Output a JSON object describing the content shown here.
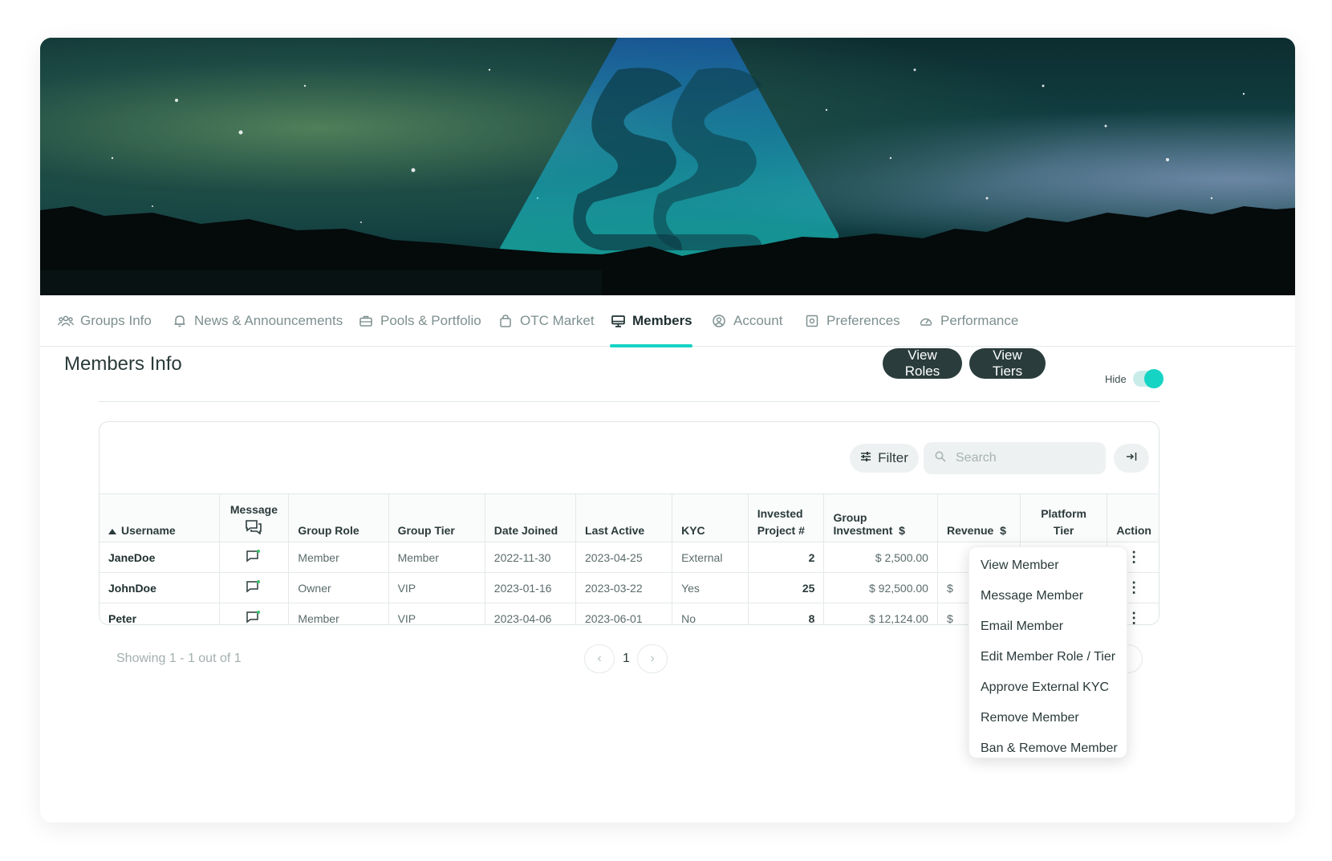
{
  "tabs": [
    {
      "label": "Groups Info",
      "icon": "group-icon"
    },
    {
      "label": "News & Announcements",
      "icon": "bell-icon"
    },
    {
      "label": "Pools & Portfolio",
      "icon": "briefcase-icon"
    },
    {
      "label": "OTC Market",
      "icon": "bag-icon"
    },
    {
      "label": "Members",
      "icon": "monitor-icon"
    },
    {
      "label": "Account",
      "icon": "user-circle-icon"
    },
    {
      "label": "Preferences",
      "icon": "settings-square-icon"
    },
    {
      "label": "Performance",
      "icon": "gauge-icon"
    }
  ],
  "active_tab": "Members",
  "section": {
    "title": "Members Info",
    "view_roles": "View Roles",
    "view_tiers": "View Tiers",
    "hide_label": "Hide",
    "hide_toggle_on": true
  },
  "toolbar": {
    "filter_label": "Filter",
    "search_placeholder": "Search"
  },
  "table": {
    "headers": {
      "username": "Username",
      "message": "Message",
      "group_role": "Group Role",
      "group_tier": "Group Tier",
      "date_joined": "Date Joined",
      "last_active": "Last Active",
      "kyc": "KYC",
      "invested_1": "Invested",
      "invested_2": "Project #",
      "group_investment": "Group Investment",
      "group_investment_unit": "$",
      "revenue": "Revenue",
      "revenue_unit": "$",
      "platform_1": "Platform",
      "platform_2": "Tier",
      "action": "Action"
    },
    "rows": [
      {
        "username": "JaneDoe",
        "group_role": "Member",
        "group_tier": "Member",
        "date_joined": "2022-11-30",
        "last_active": "2023-04-25",
        "kyc": "External",
        "invested": "2",
        "group_investment": "$ 2,500.00",
        "revenue": "",
        "platform_tier": ""
      },
      {
        "username": "JohnDoe",
        "group_role": "Owner",
        "group_tier": "VIP",
        "date_joined": "2023-01-16",
        "last_active": "2023-03-22",
        "kyc": "Yes",
        "invested": "25",
        "group_investment": "$ 92,500.00",
        "revenue": "$",
        "platform_tier": ""
      },
      {
        "username": "Peter",
        "group_role": "Member",
        "group_tier": "VIP",
        "date_joined": "2023-04-06",
        "last_active": "2023-06-01",
        "kyc": "No",
        "invested": "8",
        "group_investment": "$ 12,124.00",
        "revenue": "$",
        "platform_tier": ""
      }
    ]
  },
  "footer": {
    "showing": "Showing 1 - 1 out of 1",
    "page": "1"
  },
  "action_menu": [
    "View Member",
    "Message Member",
    "Email Member",
    "Edit Member Role / Tier",
    "Approve External KYC",
    "Remove Member",
    "Ban & Remove Member"
  ],
  "colors": {
    "accent": "#16d4c4",
    "dark_button": "#2a3c3c"
  }
}
